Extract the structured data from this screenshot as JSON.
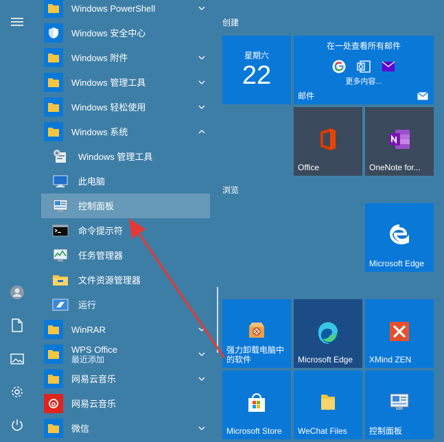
{
  "app_list": {
    "items": [
      {
        "label": "Windows PowerShell",
        "icon": "folder-icon",
        "expandable": true,
        "expanded": false
      },
      {
        "label": "Windows 安全中心",
        "icon": "shield-icon",
        "expandable": false
      },
      {
        "label": "Windows 附件",
        "icon": "folder-icon",
        "expandable": true,
        "expanded": false
      },
      {
        "label": "Windows 管理工具",
        "icon": "folder-icon",
        "expandable": true,
        "expanded": false
      },
      {
        "label": "Windows 轻松使用",
        "icon": "folder-icon",
        "expandable": true,
        "expanded": false
      },
      {
        "label": "Windows 系统",
        "icon": "folder-icon",
        "expandable": true,
        "expanded": true
      },
      {
        "label": "Windows 管理工具",
        "icon": "admin-tools-icon",
        "sub": true
      },
      {
        "label": "此电脑",
        "icon": "computer-icon",
        "sub": true
      },
      {
        "label": "控制面板",
        "icon": "control-panel-icon",
        "sub": true,
        "selected": true
      },
      {
        "label": "命令提示符",
        "icon": "cmd-icon",
        "sub": true
      },
      {
        "label": "任务管理器",
        "icon": "task-manager-icon",
        "sub": true
      },
      {
        "label": "文件资源管理器",
        "icon": "file-explorer-icon",
        "sub": true
      },
      {
        "label": "运行",
        "icon": "run-icon",
        "sub": true
      },
      {
        "label": "WinRAR",
        "icon": "folder-icon",
        "expandable": true,
        "expanded": false
      },
      {
        "label": "WPS Office",
        "sublabel": "最近添加",
        "icon": "folder-icon",
        "expandable": true,
        "expanded": false
      },
      {
        "label": "网易云音乐",
        "icon": "folder-icon",
        "expandable": true,
        "expanded": false
      },
      {
        "label": "网易云音乐",
        "icon": "netease-music-icon",
        "expandable": false
      },
      {
        "label": "微信",
        "icon": "folder-icon",
        "expandable": true,
        "expanded": false
      }
    ]
  },
  "groups": {
    "create": "创建",
    "browse": "浏览"
  },
  "tiles": {
    "calendar": {
      "weekday": "星期六",
      "day": "22"
    },
    "mail": {
      "header": "在一处查看所有邮件",
      "more": "更多内容...",
      "name": "邮件"
    },
    "office": {
      "name": "Office"
    },
    "onenote": {
      "name": "OneNote for..."
    },
    "edge_old": {
      "name": "Microsoft Edge"
    },
    "uninstaller": {
      "name": "强力卸载电脑中的软件"
    },
    "edge_new": {
      "name": "Microsoft Edge"
    },
    "xmind": {
      "name": "XMind ZEN"
    },
    "store": {
      "name": "Microsoft Store"
    },
    "wechat_files": {
      "name": "WeChat Files"
    },
    "control_panel": {
      "name": "控制面板"
    }
  },
  "colors": {
    "background": "#3d7ea6",
    "tile_blue": "#0a78d7",
    "arrow": "#e53935"
  }
}
